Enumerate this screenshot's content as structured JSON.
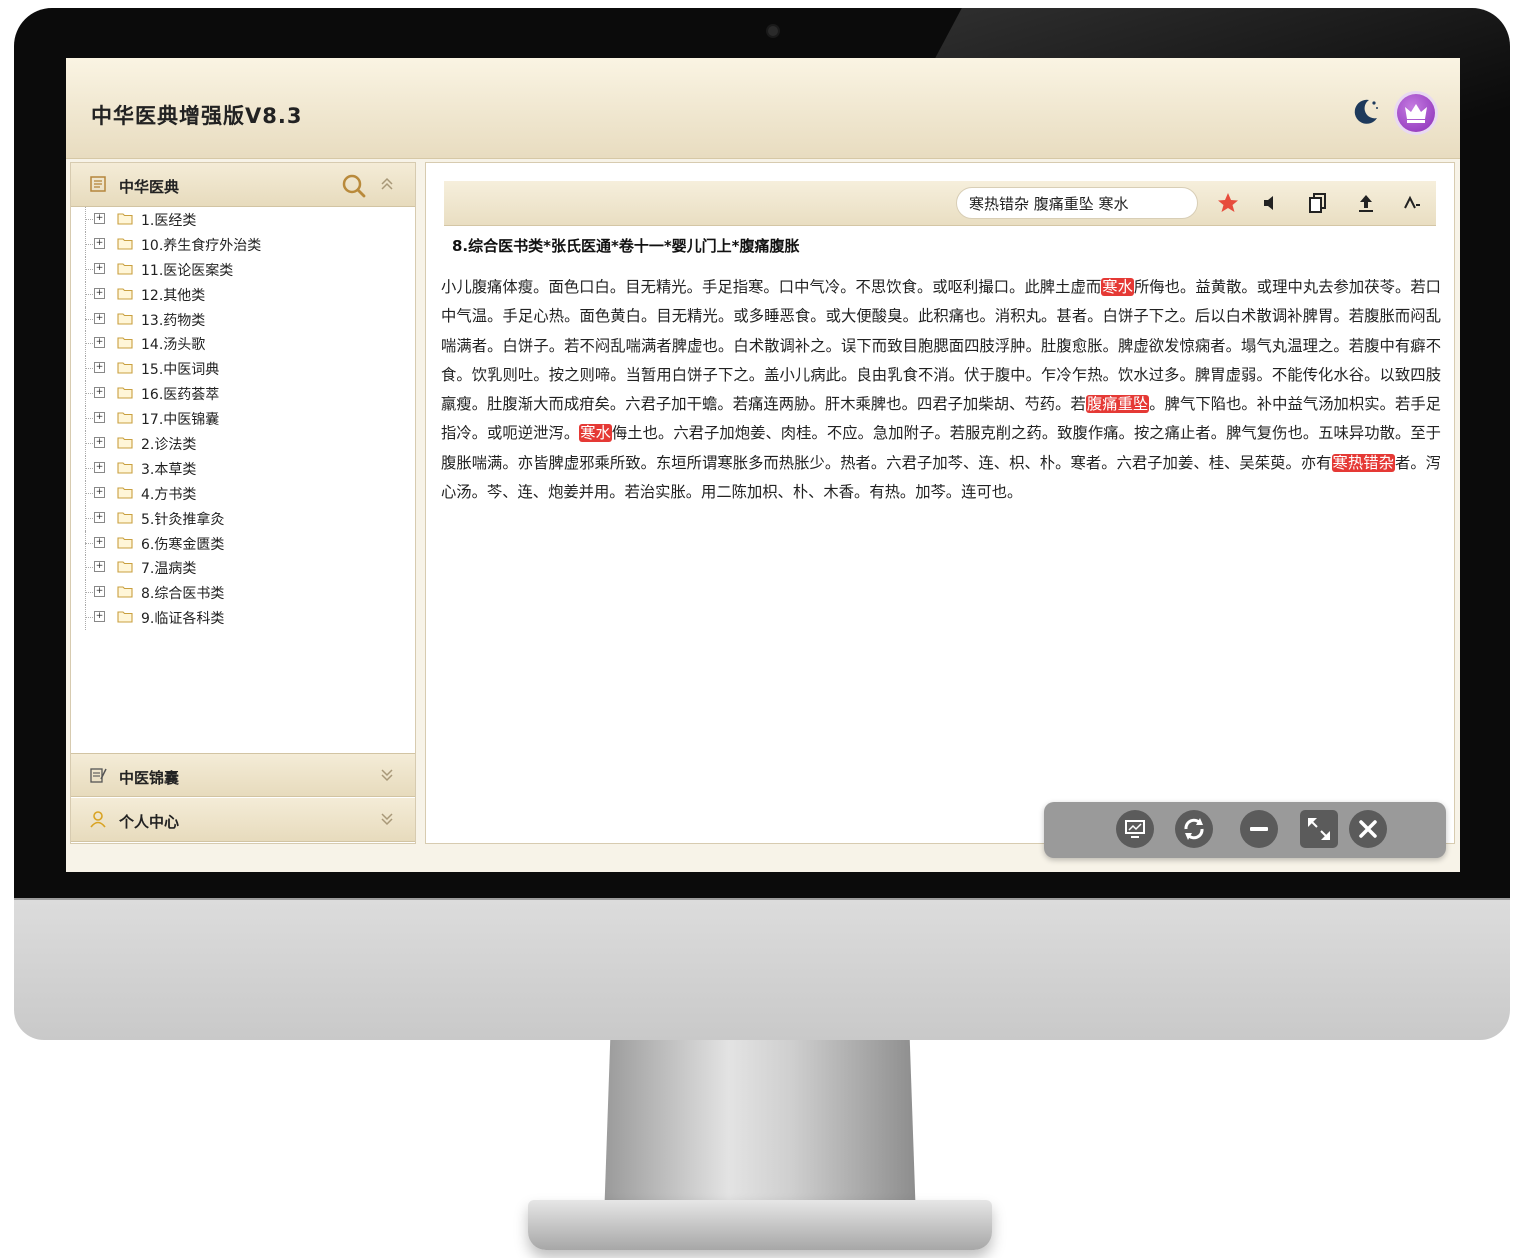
{
  "app": {
    "title": "中华医典增强版V8.3"
  },
  "sidebar": {
    "section_main": {
      "label": "中华医典"
    },
    "tree": [
      "1.医经类",
      "10.养生食疗外治类",
      "11.医论医案类",
      "12.其他类",
      "13.药物类",
      "14.汤头歌",
      "15.中医词典",
      "16.医药荟萃",
      "17.中医锦囊",
      "2.诊法类",
      "3.本草类",
      "4.方书类",
      "5.针灸推拿灸",
      "6.伤寒金匮类",
      "7.温病类",
      "8.综合医书类",
      "9.临证各科类"
    ],
    "section_jinnang": {
      "label": "中医锦囊"
    },
    "section_personal": {
      "label": "个人中心"
    }
  },
  "toolbar": {
    "search_value": "寒热错杂 腹痛重坠 寒水"
  },
  "document": {
    "title": "8.综合医书类*张氏医通*卷十一*婴儿门上*腹痛腹胀",
    "segments": [
      {
        "text": "小儿腹痛体瘦。面色口白。目无精光。手足指寒。口中气冷。不思饮食。或呕利撮口。此脾土虚而",
        "hl": false
      },
      {
        "text": "寒水",
        "hl": true
      },
      {
        "text": "所侮也。益黄散。或理中丸去参加茯苓。若口中气温。手足心热。面色黄白。目无精光。或多睡恶食。或大便酸臭。此积痛也。消积丸。甚者。白饼子下之。后以白术散调补脾胃。若腹胀而闷乱喘满者。白饼子。若不闷乱喘满者脾虚也。白术散调补之。误下而致目胞腮面四肢浮肿。肚腹愈胀。脾虚欲发惊痫者。塌气丸温理之。若腹中有癖不食。饮乳则吐。按之则啼。当暂用白饼子下之。盖小儿病此。良由乳食不消。伏于腹中。乍冷乍热。饮水过多。脾胃虚弱。不能传化水谷。以致四肢羸瘦。肚腹渐大而成疳矣。六君子加干蟾。若痛连两胁。肝木乘脾也。四君子加柴胡、芍药。若",
        "hl": false
      },
      {
        "text": "腹痛重坠",
        "hl": true
      },
      {
        "text": "。脾气下陷也。补中益气汤加枳实。若手足指冷。或呃逆泄泻。",
        "hl": false
      },
      {
        "text": "寒水",
        "hl": true
      },
      {
        "text": "侮土也。六君子加炮姜、肉桂。不应。急加附子。若服克削之药。致腹作痛。按之痛止者。脾气复伤也。五味异功散。至于腹胀喘满。亦皆脾虚邪乘所致。东垣所谓寒胀多而热胀少。热者。六君子加芩、连、枳、朴。寒者。六君子加姜、桂、吴茱萸。亦有",
        "hl": false
      },
      {
        "text": "寒热错杂",
        "hl": true
      },
      {
        "text": "者。泻心汤。芩、连、炮姜并用。若治实胀。用二陈加枳、朴、木香。有热。加芩。连可也。",
        "hl": false
      }
    ]
  },
  "colors": {
    "highlight": "#e53935",
    "accent_star": "#e74c3c",
    "crown": "#9b3fc9"
  }
}
